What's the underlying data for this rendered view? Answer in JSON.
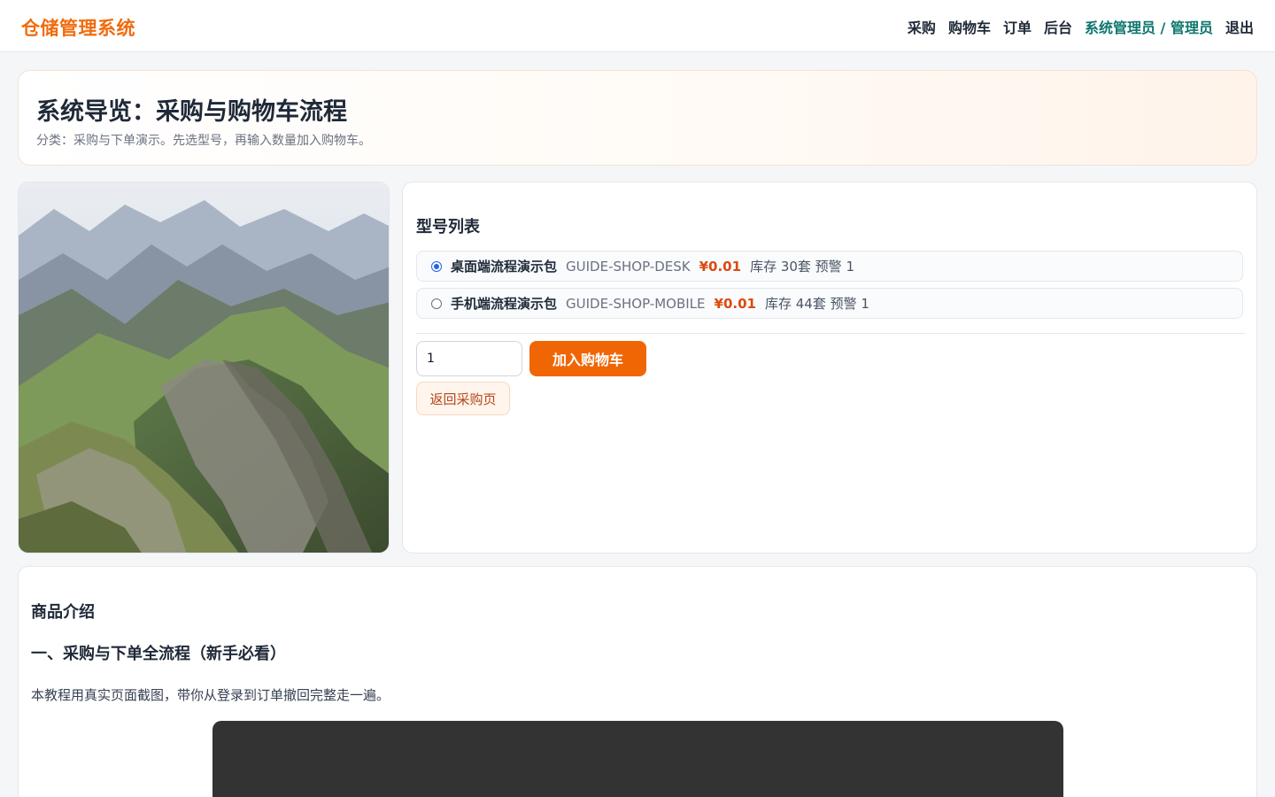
{
  "app": {
    "brand": "仓储管理系统"
  },
  "nav": {
    "items": [
      "采购",
      "购物车",
      "订单",
      "后台"
    ],
    "user": "系统管理员 / 管理员",
    "logout": "退出"
  },
  "hero": {
    "title": "系统导览：采购与购物车流程",
    "subtitle": "分类：采购与下单演示。先选型号，再输入数量加入购物车。"
  },
  "models": {
    "heading": "型号列表",
    "items": [
      {
        "name": "桌面端流程演示包",
        "code": "GUIDE-SHOP-DESK",
        "price": "¥0.01",
        "stock": "库存 30套 预警 1",
        "selected": true
      },
      {
        "name": "手机端流程演示包",
        "code": "GUIDE-SHOP-MOBILE",
        "price": "¥0.01",
        "stock": "库存 44套 预警 1",
        "selected": false
      }
    ],
    "quantity": "1",
    "add_label": "加入购物车",
    "back_label": "返回采购页"
  },
  "intro": {
    "heading": "商品介绍",
    "section_title": "一、采购与下单全流程（新手必看）",
    "text": "本教程用真实页面截图，带你从登录到订单撤回完整走一遍。"
  },
  "colors": {
    "brand": "#f06c0d",
    "accent_button": "#f06605",
    "price": "#dc4a0f",
    "user": "#0f766e"
  },
  "icons": {
    "product_image": "mountain-landscape-image"
  }
}
